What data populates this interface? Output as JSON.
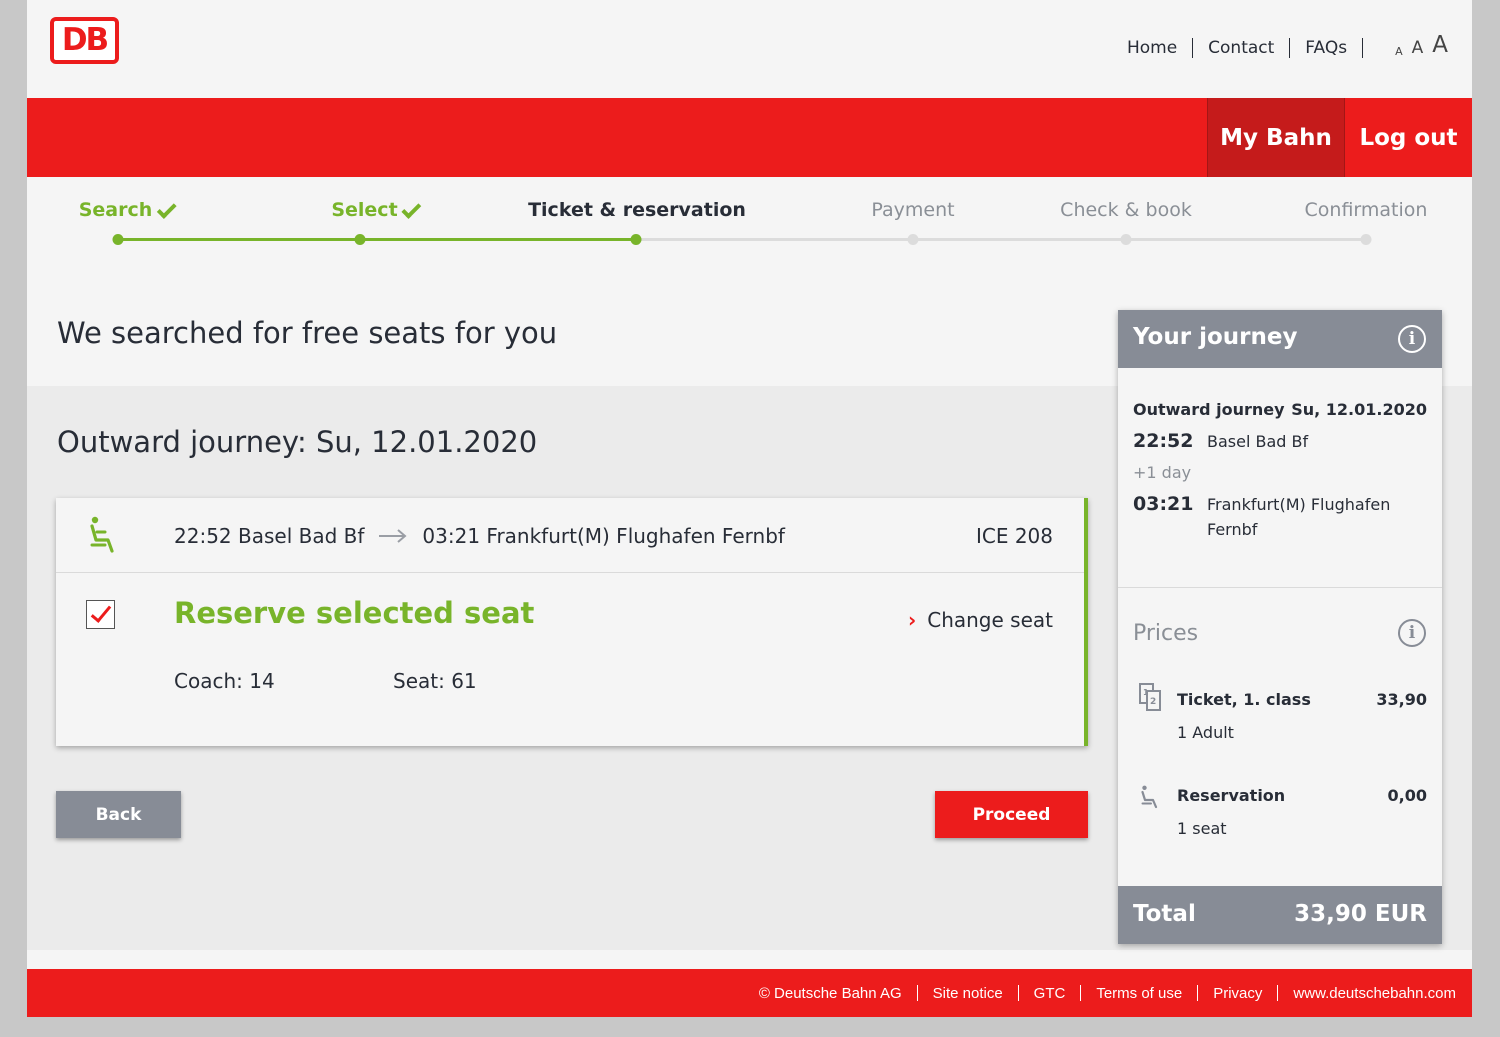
{
  "brand": {
    "logo_text": "DB",
    "accent": "#ec1c1c",
    "green": "#78b42a",
    "gray": "#878c96"
  },
  "topnav": {
    "home": "Home",
    "contact": "Contact",
    "faqs": "FAQs",
    "font_small": "A",
    "font_medium": "A",
    "font_large": "A"
  },
  "userbar": {
    "my_bahn": "My Bahn",
    "log_out": "Log out"
  },
  "steps": [
    {
      "label": "Search",
      "state": "done"
    },
    {
      "label": "Select",
      "state": "done"
    },
    {
      "label": "Ticket & reservation",
      "state": "active"
    },
    {
      "label": "Payment",
      "state": "todo"
    },
    {
      "label": "Check & book",
      "state": "todo"
    },
    {
      "label": "Confirmation",
      "state": "todo"
    }
  ],
  "main": {
    "headline": "We searched for free seats for you",
    "outward_title": "Outward journey: Su, 12.01.2020",
    "connection": {
      "icon": "seat-icon",
      "departure": "22:52 Basel Bad Bf",
      "arrival": "03:21 Frankfurt(M) Flughafen Fernbf",
      "train": "ICE 208"
    },
    "reservation": {
      "checked": true,
      "title": "Reserve selected seat",
      "change_label": "Change seat",
      "coach": "Coach: 14",
      "seat": "Seat: 61"
    },
    "back_label": "Back",
    "proceed_label": "Proceed"
  },
  "sidebar": {
    "title": "Your journey",
    "journey_label": "Outward journey",
    "journey_date": "Su, 12.01.2020",
    "dep_time": "22:52",
    "dep_station": "Basel Bad Bf",
    "day_offset": "+1 day",
    "arr_time": "03:21",
    "arr_station_line1": "Frankfurt(M) Flughafen",
    "arr_station_line2": "Fernbf",
    "prices_label": "Prices",
    "ticket_label": "Ticket, 1. class",
    "ticket_price": "33,90",
    "ticket_sub": "1 Adult",
    "reservation_label": "Reservation",
    "reservation_price": "0,00",
    "reservation_sub": "1 seat",
    "total_label": "Total",
    "total_amount": "33,90 EUR"
  },
  "footer": {
    "copyright": "© Deutsche Bahn AG",
    "site_notice": "Site notice",
    "gtc": "GTC",
    "terms": "Terms of use",
    "privacy": "Privacy",
    "website": "www.deutschebahn.com"
  }
}
